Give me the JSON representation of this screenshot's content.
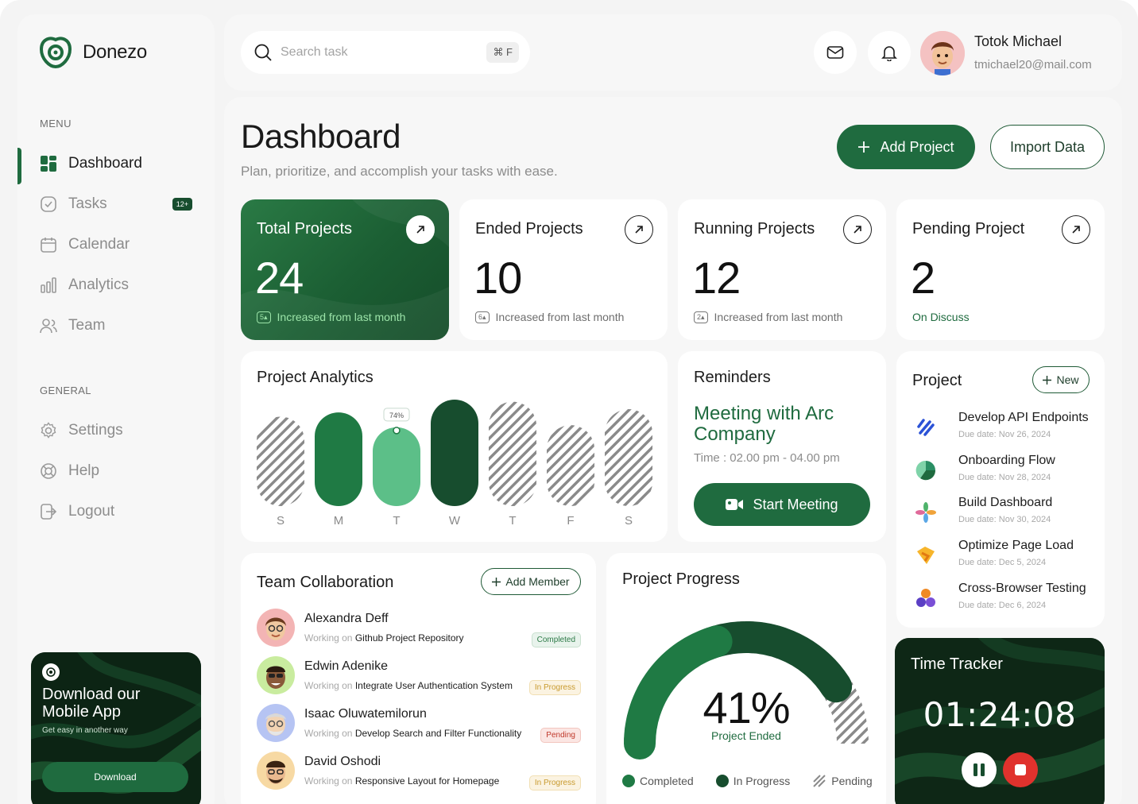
{
  "brand": {
    "name": "Donezo"
  },
  "menu": {
    "label": "MENU",
    "items": [
      {
        "label": "Dashboard",
        "active": true,
        "icon": "grid-icon"
      },
      {
        "label": "Tasks",
        "badge": "12+",
        "icon": "clipboard-check-icon"
      },
      {
        "label": "Calendar",
        "icon": "calendar-icon"
      },
      {
        "label": "Analytics",
        "icon": "bar-chart-icon"
      },
      {
        "label": "Team",
        "icon": "users-icon"
      }
    ]
  },
  "general": {
    "label": "GENERAL",
    "items": [
      {
        "label": "Settings",
        "icon": "gear-icon"
      },
      {
        "label": "Help",
        "icon": "lifebuoy-icon"
      },
      {
        "label": "Logout",
        "icon": "logout-icon"
      }
    ]
  },
  "promo": {
    "title": "Download our Mobile App",
    "subtitle": "Get easy in another way",
    "button": "Download"
  },
  "search": {
    "placeholder": "Search task",
    "shortcut": "⌘ F"
  },
  "user": {
    "name": "Totok Michael",
    "email": "tmichael20@mail.com"
  },
  "header": {
    "title": "Dashboard",
    "subtitle": "Plan, prioritize, and accomplish your tasks with ease.",
    "add_project": "Add Project",
    "import_data": "Import Data"
  },
  "stats": [
    {
      "title": "Total Projects",
      "value": "24",
      "tag": "5",
      "note": "Increased from last month"
    },
    {
      "title": "Ended Projects",
      "value": "10",
      "tag": "6",
      "note": "Increased from last month"
    },
    {
      "title": "Running Projects",
      "value": "12",
      "tag": "2",
      "note": "Increased from last month"
    },
    {
      "title": "Pending Project",
      "value": "2",
      "note": "On Discuss"
    }
  ],
  "analytics": {
    "title": "Project Analytics",
    "tooltip": "74%"
  },
  "chart_data": {
    "type": "bar",
    "categories": [
      "S",
      "M",
      "T",
      "W",
      "T",
      "F",
      "S"
    ],
    "values": [
      0.84,
      0.88,
      0.74,
      1.0,
      0.98,
      0.76,
      0.91
    ],
    "styles": [
      "hatched",
      "solid-green",
      "light-green",
      "dark-green",
      "hatched",
      "hatched",
      "hatched"
    ],
    "annotation": {
      "index": 2,
      "label": "74%"
    }
  },
  "reminders": {
    "title": "Reminders",
    "meeting": "Meeting with Arc Company",
    "time": "Time : 02.00 pm - 04.00 pm",
    "button": "Start Meeting"
  },
  "projects": {
    "title": "Project",
    "new_button": "New",
    "items": [
      {
        "name": "Develop API Endpoints",
        "due": "Due date: Nov 26, 2024",
        "icon": "slashes-icon"
      },
      {
        "name": "Onboarding Flow",
        "due": "Due date: Nov 28, 2024",
        "icon": "pie-icon"
      },
      {
        "name": "Build Dashboard",
        "due": "Due date: Nov 30, 2024",
        "icon": "pinwheel-icon"
      },
      {
        "name": "Optimize Page Load",
        "due": "Due date: Dec 5, 2024",
        "icon": "lightning-icon"
      },
      {
        "name": "Cross-Browser Testing",
        "due": "Due date: Dec 6, 2024",
        "icon": "circles-icon"
      }
    ]
  },
  "team": {
    "title": "Team Collaboration",
    "add_member": "Add Member",
    "working_on": "Working on",
    "members": [
      {
        "name": "Alexandra Deff",
        "task": "Github Project Repository",
        "status": "Completed",
        "status_color": "#2d7a47",
        "status_bg": "#e8f3ec",
        "avatar_bg": "#f3b4b4"
      },
      {
        "name": "Edwin Adenike",
        "task": "Integrate User Authentication System",
        "status": "In Progress",
        "status_color": "#c89a2e",
        "status_bg": "#fbf3e1",
        "avatar_bg": "#c9ec9f"
      },
      {
        "name": "Isaac Oluwatemilorun",
        "task": "Develop Search and Filter Functionality",
        "status": "Pending",
        "status_color": "#c0392b",
        "status_bg": "#fbe6e3",
        "avatar_bg": "#b6c4f3"
      },
      {
        "name": "David Oshodi",
        "task": "Responsive Layout for Homepage",
        "status": "In Progress",
        "status_color": "#c89a2e",
        "status_bg": "#fbf3e1",
        "avatar_bg": "#f7d9a3"
      }
    ]
  },
  "progress": {
    "title": "Project Progress",
    "value": "41%",
    "percent": 41,
    "label": "Project Ended",
    "legend": [
      "Completed",
      "In Progress",
      "Pending"
    ]
  },
  "tracker": {
    "title": "Time Tracker",
    "time": "01:24:08"
  },
  "colors": {
    "accent": "#1f6b3f",
    "dark": "#174d2e",
    "light": "#5cbf88"
  }
}
